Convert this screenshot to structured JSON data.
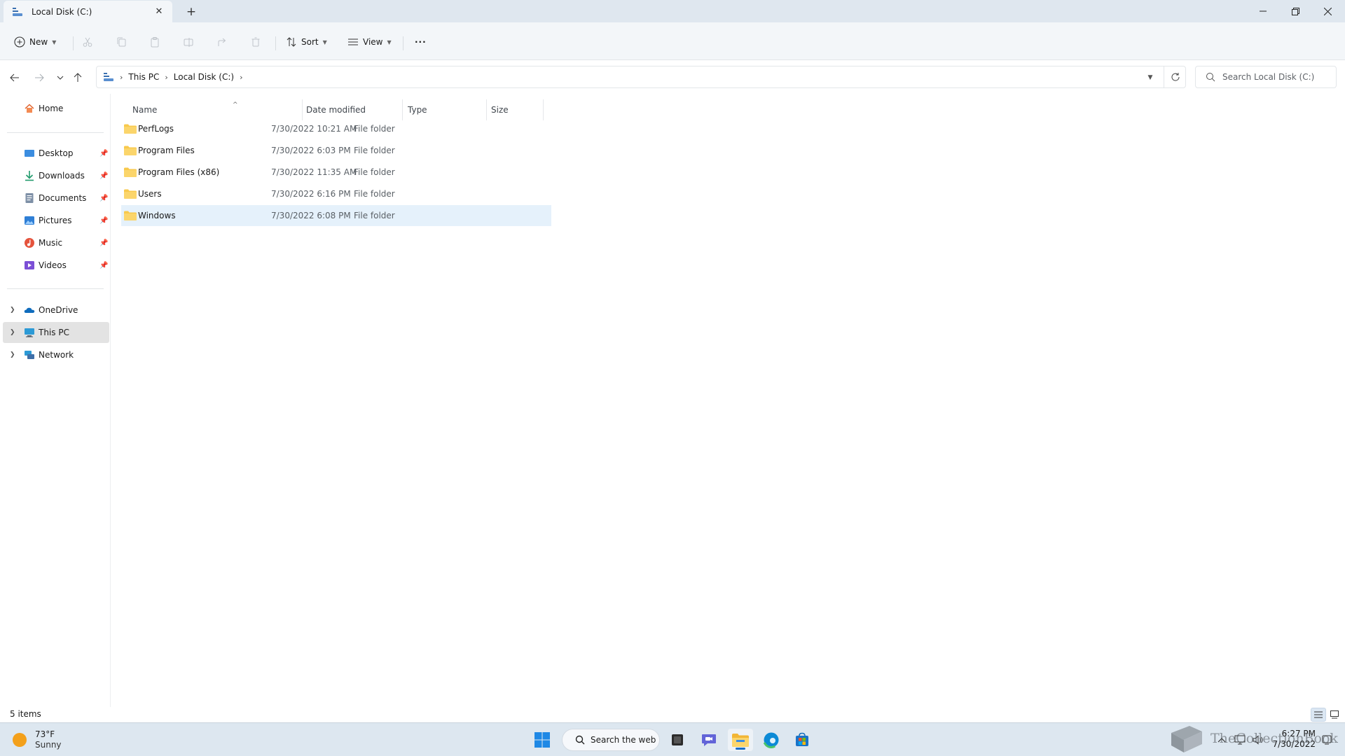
{
  "window": {
    "tab_title": "Local Disk (C:)",
    "new_tab_symbol": "+"
  },
  "toolbar": {
    "new_label": "New",
    "sort_label": "Sort",
    "view_label": "View",
    "more_label": "···"
  },
  "address": {
    "crumbs": [
      "This PC",
      "Local Disk (C:)"
    ],
    "search_placeholder": "Search Local Disk (C:)"
  },
  "sidebar": {
    "home": "Home",
    "quick_access": [
      {
        "label": "Desktop",
        "icon": "desktop-icon"
      },
      {
        "label": "Downloads",
        "icon": "downloads-icon"
      },
      {
        "label": "Documents",
        "icon": "documents-icon"
      },
      {
        "label": "Pictures",
        "icon": "pictures-icon"
      },
      {
        "label": "Music",
        "icon": "music-icon"
      },
      {
        "label": "Videos",
        "icon": "videos-icon"
      }
    ],
    "locations": [
      {
        "label": "OneDrive",
        "icon": "onedrive-icon"
      },
      {
        "label": "This PC",
        "icon": "this-pc-icon",
        "selected": true
      },
      {
        "label": "Network",
        "icon": "network-icon"
      }
    ]
  },
  "file_list": {
    "columns": {
      "name": "Name",
      "date": "Date modified",
      "type": "Type",
      "size": "Size"
    },
    "rows": [
      {
        "name": "PerfLogs",
        "date": "7/30/2022 10:21 AM",
        "type": "File folder",
        "size": ""
      },
      {
        "name": "Program Files",
        "date": "7/30/2022 6:03 PM",
        "type": "File folder",
        "size": ""
      },
      {
        "name": "Program Files (x86)",
        "date": "7/30/2022 11:35 AM",
        "type": "File folder",
        "size": ""
      },
      {
        "name": "Users",
        "date": "7/30/2022 6:16 PM",
        "type": "File folder",
        "size": ""
      },
      {
        "name": "Windows",
        "date": "7/30/2022 6:08 PM",
        "type": "File folder",
        "size": "",
        "selected": true
      }
    ]
  },
  "status": {
    "item_count": "5 items"
  },
  "taskbar": {
    "weather_temp": "73°F",
    "weather_condition": "Sunny",
    "search_label": "Search the web",
    "time": "6:27 PM",
    "date": "7/30/2022",
    "watermark": "TheCollectionBook"
  },
  "colors": {
    "accent": "#0067c0",
    "folder": "#f8c94c",
    "selection": "#e5f1fb",
    "titlebar": "#dfe7ef",
    "commandbar": "#f3f6f9"
  }
}
